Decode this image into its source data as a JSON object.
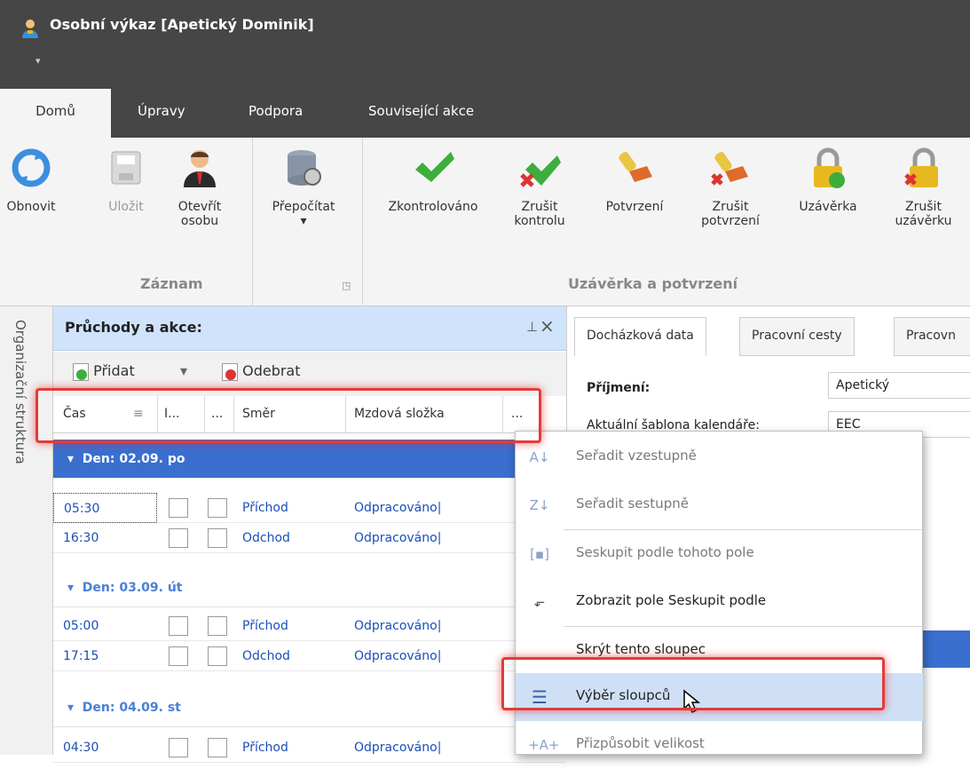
{
  "window": {
    "title": "Osobní výkaz [Apetický Dominik]"
  },
  "tabs": [
    "Domů",
    "Úpravy",
    "Podpora",
    "Související akce"
  ],
  "ribbon": {
    "groups": [
      "Záznam",
      "Uzávěrka a potvrzení"
    ],
    "buttons": [
      {
        "label": "Obnovit",
        "icon": "refresh-icon"
      },
      {
        "label": "Uložit",
        "icon": "save-icon"
      },
      {
        "label": "Otevřít",
        "label2": "osobu",
        "icon": "person-icon"
      },
      {
        "label": "Přepočítat",
        "icon": "database-icon"
      },
      {
        "label": "Zkontrolováno",
        "icon": "checkmark-icon"
      },
      {
        "label": "Zrušit",
        "label2": "kontrolu",
        "icon": "cancel-check-icon"
      },
      {
        "label": "Potvrzení",
        "icon": "stamp-icon"
      },
      {
        "label": "Zrušit",
        "label2": "potvrzení",
        "icon": "cancel-stamp-icon"
      },
      {
        "label": "Uzávěrka",
        "icon": "lock-icon"
      },
      {
        "label": "Zrušit",
        "label2": "uzávěrku",
        "icon": "cancel-lock-icon"
      }
    ]
  },
  "left_strip": {
    "label": "Organizační struktura"
  },
  "panel": {
    "title": "Průchody a akce:",
    "toolbar": {
      "add": "Přidat",
      "remove": "Odebrat"
    },
    "columns": [
      "Čas",
      "I...",
      "...",
      "Směr",
      "Mzdová složka",
      "..."
    ],
    "groups": [
      {
        "label": "Den: 02.09. po",
        "rows": [
          {
            "time": "05:30",
            "dir": "Příchod",
            "wage": "Odpracováno|"
          },
          {
            "time": "16:30",
            "dir": "Odchod",
            "wage": "Odpracováno|"
          }
        ]
      },
      {
        "label": "Den: 03.09. út",
        "rows": [
          {
            "time": "05:00",
            "dir": "Příchod",
            "wage": "Odpracováno|"
          },
          {
            "time": "17:15",
            "dir": "Odchod",
            "wage": "Odpracováno|"
          }
        ]
      },
      {
        "label": "Den: 04.09. st",
        "rows": [
          {
            "time": "04:30",
            "dir": "Příchod",
            "wage": "Odpracováno|"
          }
        ]
      }
    ]
  },
  "right": {
    "tabs": [
      "Docházková data",
      "Pracovní cesty",
      "Pracovn"
    ],
    "fields": [
      {
        "label": "Příjmení:",
        "value": "Apetický"
      },
      {
        "label": "Aktuální šablona kalendáře:",
        "value": "EEC"
      }
    ]
  },
  "context_menu": {
    "items": [
      {
        "label": "Seřadit vzestupně",
        "icon": "sort-ascending-icon"
      },
      {
        "label": "Seřadit sestupně",
        "icon": "sort-descending-icon"
      },
      {
        "label": "Seskupit podle tohoto pole",
        "icon": "group-by-icon"
      },
      {
        "label": "Zobrazit pole Seskupit podle",
        "icon": "show-group-panel-icon"
      },
      {
        "label": "Skrýt tento sloupec",
        "icon": ""
      },
      {
        "label": "Výběr sloupců",
        "icon": "column-chooser-icon"
      },
      {
        "label": "Přizpůsobit velikost",
        "icon": "best-fit-icon"
      }
    ]
  },
  "colors": {
    "accent": "#3a6fcf",
    "highlight": "#e23b3b",
    "panel_header": "#cfe3fb",
    "menu_active": "#cfe0f6"
  }
}
